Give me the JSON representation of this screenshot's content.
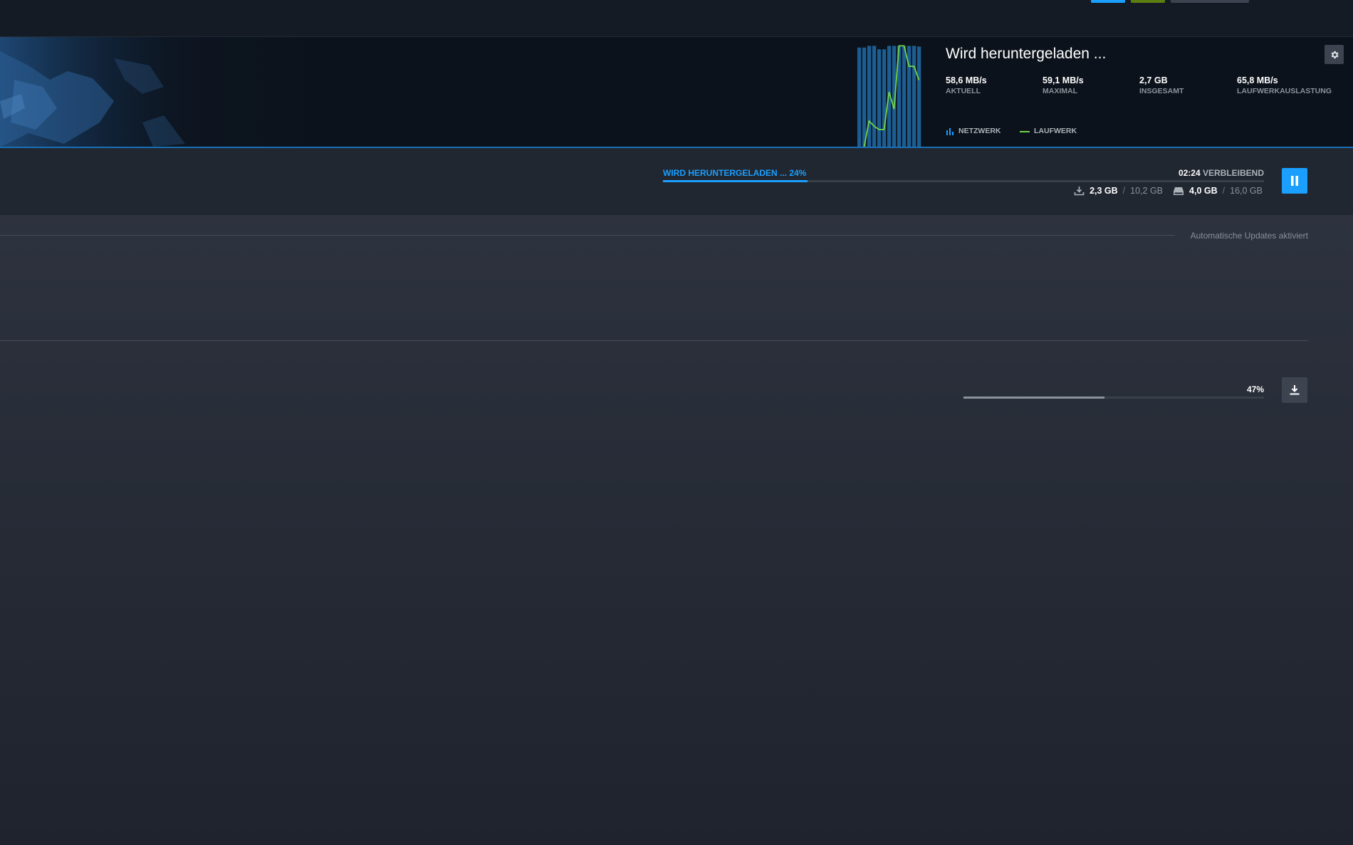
{
  "colors": {
    "accent": "#1a9fff",
    "network_bar": "#1c5e92",
    "disk_line": "#6fd54a",
    "background": "#2a303b",
    "header_bg": "#0c121b"
  },
  "topbar": {
    "pills": [
      "#1a9fff",
      "#5c7e10",
      "#3d4450"
    ]
  },
  "header": {
    "art_icon": "game-art-image",
    "title": "Wird heruntergeladen ...",
    "settings_icon": "gear-icon",
    "stats": [
      {
        "value": "58,6 MB/s",
        "label": "AKTUELL"
      },
      {
        "value": "59,1 MB/s",
        "label": "MAXIMAL"
      },
      {
        "value": "2,7 GB",
        "label": "INSGESAMT"
      },
      {
        "value": "65,8 MB/s",
        "label": "LAUFWERKAUSLASTUNG"
      }
    ],
    "legend": {
      "network": "NETZWERK",
      "disk": "LAUFWERK"
    }
  },
  "chart_data": {
    "type": "bar",
    "series": [
      {
        "name": "NETZWERK",
        "type": "bar",
        "values": [
          0,
          0,
          0,
          0,
          0,
          0,
          0,
          0,
          0,
          0,
          0,
          0,
          0,
          0,
          0,
          58,
          58,
          59,
          59,
          57,
          57,
          59,
          59,
          59,
          59,
          59,
          59,
          58.6
        ]
      },
      {
        "name": "LAUFWERK",
        "type": "line",
        "values": [
          0,
          0,
          0,
          0,
          0,
          0,
          0,
          0,
          0,
          0,
          0,
          0,
          0,
          0,
          0,
          0,
          0,
          15,
          12,
          10,
          10,
          32,
          22,
          59,
          59,
          47,
          47,
          39
        ]
      }
    ],
    "ylim": [
      0,
      60
    ]
  },
  "progress": {
    "label": "WIRD HERUNTERGELADEN ... 24%",
    "percent": 24,
    "time_remaining": "02:24",
    "remaining_word": "VERBLEIBEND",
    "download_icon": "download-icon",
    "download_current": "2,3 GB",
    "download_total": "10,2 GB",
    "disk_icon": "disk-icon",
    "disk_current": "4,0 GB",
    "disk_total": "16,0 GB",
    "separator": "/",
    "pause_icon": "pause-icon"
  },
  "auto_updates": "Automatische Updates aktiviert",
  "queue": {
    "percent_label": "47%",
    "percent": 47,
    "button_icon": "download-icon"
  }
}
